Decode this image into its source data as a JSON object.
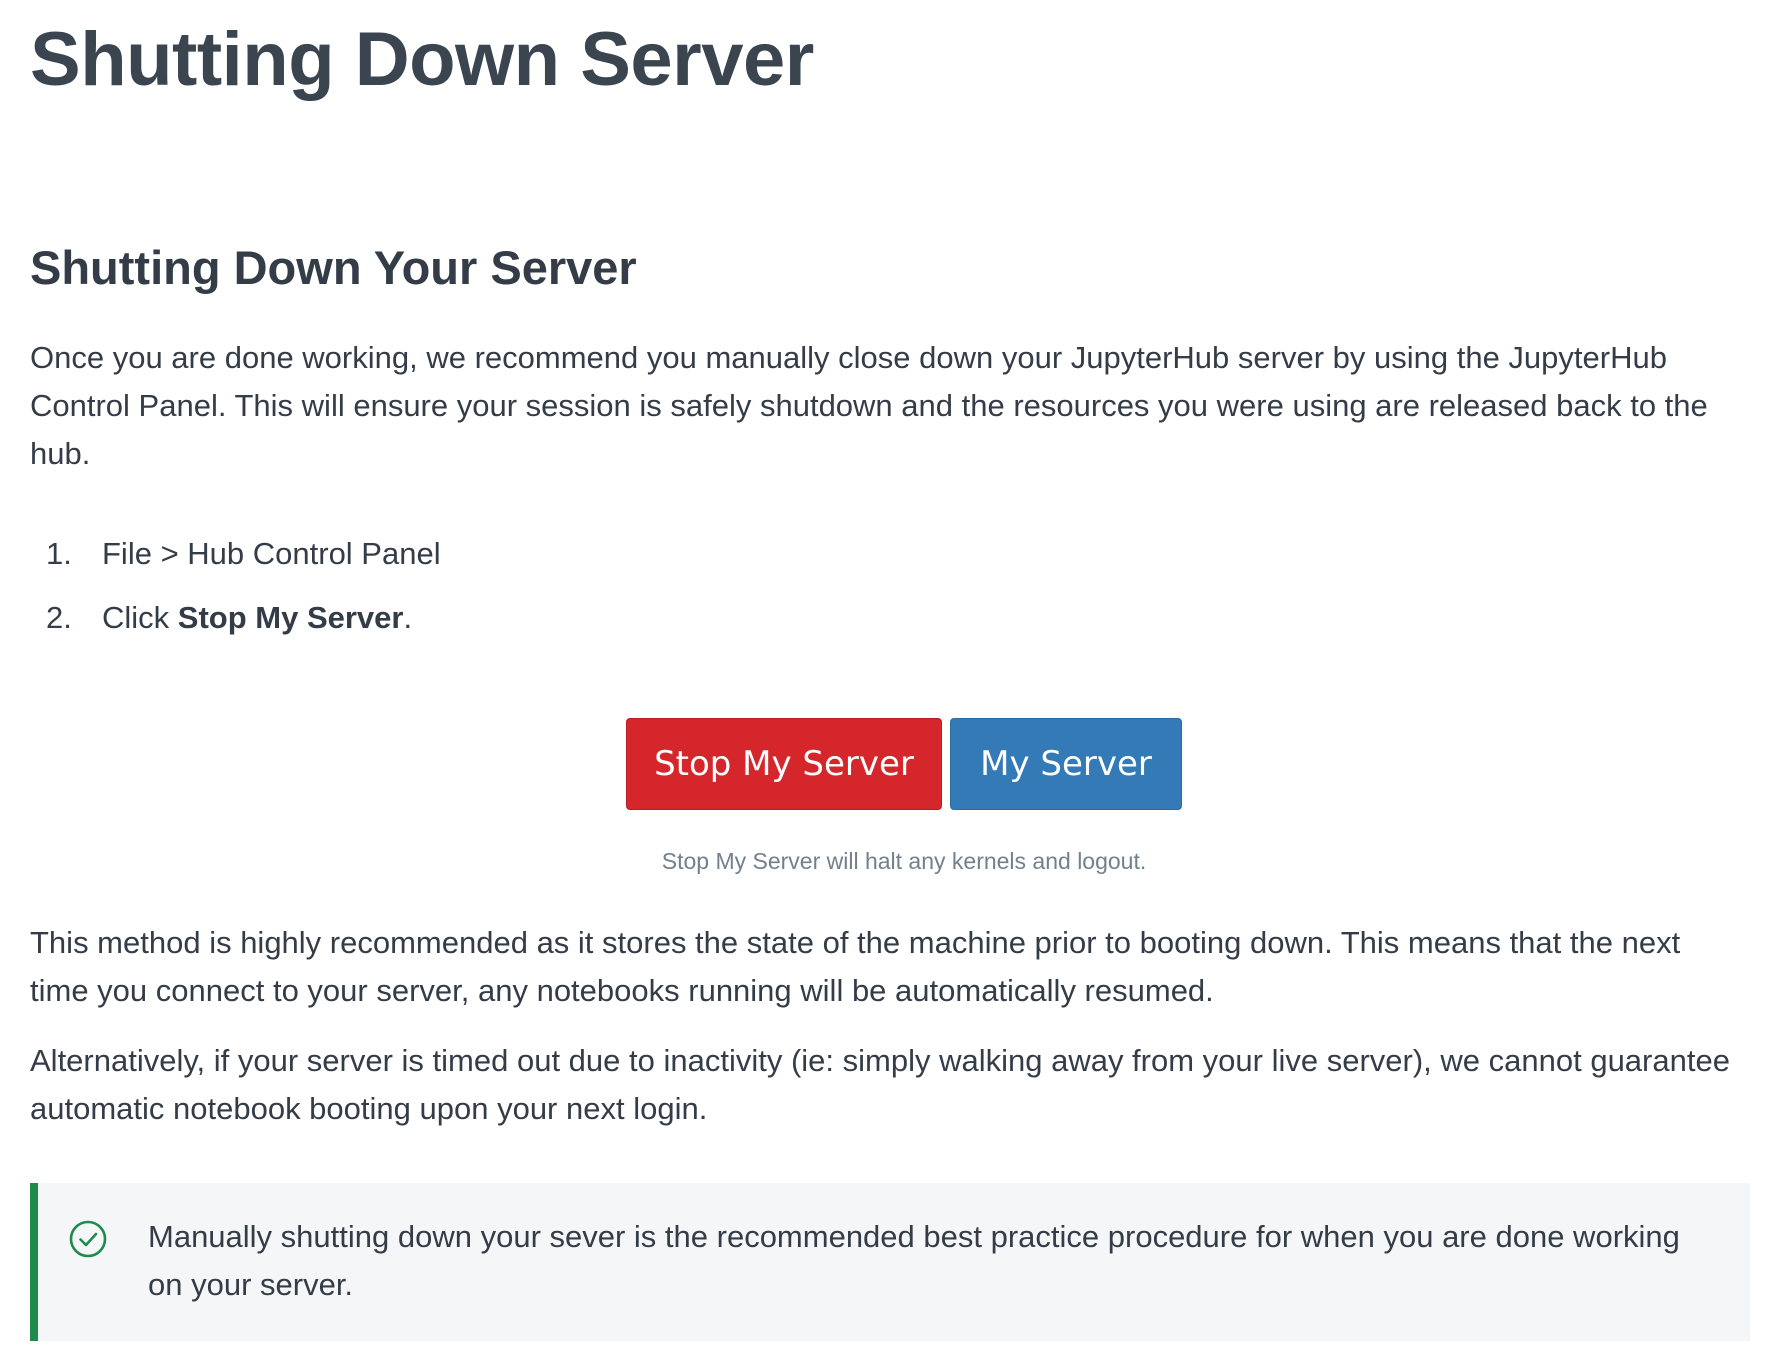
{
  "page": {
    "title": "Shutting Down Server"
  },
  "section": {
    "heading": "Shutting Down Your Server",
    "intro": "Once you are done working, we recommend you manually close down your JupyterHub server by using the JupyterHub Control Panel. This will ensure your session is safely shutdown and the resources you were using are released back to the hub.",
    "steps": [
      {
        "number": "1.",
        "text": "File > Hub Control Panel"
      },
      {
        "number": "2.",
        "prefix": "Click ",
        "bold": "Stop My Server",
        "suffix": "."
      }
    ],
    "figure": {
      "stop_button_label": "Stop My Server",
      "my_server_button_label": "My Server",
      "caption": "Stop My Server will halt any kernels and logout."
    },
    "method_paragraph": "This method is highly recommended as it stores the state of the machine prior to booting down. This means that the next time you connect to your server, any notebooks running will be automatically resumed.",
    "alternative_paragraph": "Alternatively, if your server is timed out due to inactivity (ie: simply walking away from your live server), we cannot guarantee automatic notebook booting upon your next login.",
    "callout": {
      "icon": "check-circle-icon",
      "text": "Manually shutting down your sever is the recommended best practice procedure for when you are done working on your server."
    }
  },
  "colors": {
    "danger": "#d5262b",
    "primary": "#337ab7",
    "success_border": "#1f8a4c",
    "callout_bg": "#f4f6f8"
  }
}
